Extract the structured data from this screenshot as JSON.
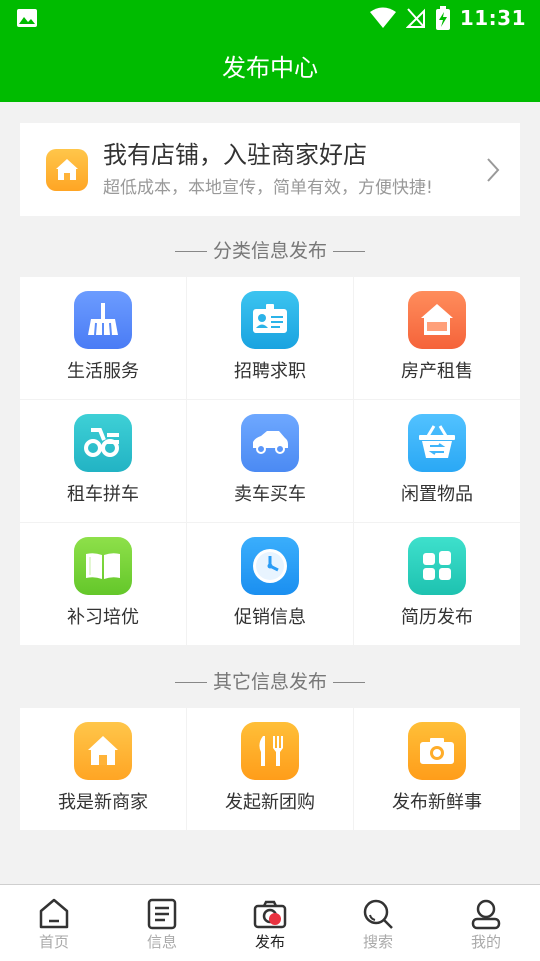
{
  "status_bar": {
    "time": "11:31"
  },
  "header": {
    "title": "发布中心",
    "background": "#00bb00"
  },
  "merchant_banner": {
    "title": "我有店铺，入驻商家好店",
    "subtitle": "超低成本，本地宣传，简单有效，方便快捷!"
  },
  "category_section": {
    "title": "分类信息发布",
    "items": [
      {
        "label": "生活服务",
        "icon": "broom-icon"
      },
      {
        "label": "招聘求职",
        "icon": "id-card-icon"
      },
      {
        "label": "房产租售",
        "icon": "house-icon"
      },
      {
        "label": "租车拼车",
        "icon": "bike-icon"
      },
      {
        "label": "卖车买车",
        "icon": "car-icon"
      },
      {
        "label": "闲置物品",
        "icon": "basket-icon"
      },
      {
        "label": "补习培优",
        "icon": "book-icon"
      },
      {
        "label": "促销信息",
        "icon": "clock-icon"
      },
      {
        "label": "简历发布",
        "icon": "blocks-icon"
      }
    ]
  },
  "other_section": {
    "title": "其它信息发布",
    "items": [
      {
        "label": "我是新商家",
        "icon": "shop-icon"
      },
      {
        "label": "发起新团购",
        "icon": "cutlery-icon"
      },
      {
        "label": "发布新鲜事",
        "icon": "camera-icon"
      }
    ]
  },
  "bottom_nav": {
    "items": [
      {
        "label": "首页",
        "icon": "home-icon",
        "active": false
      },
      {
        "label": "信息",
        "icon": "list-icon",
        "active": false
      },
      {
        "label": "发布",
        "icon": "camera-icon",
        "active": true
      },
      {
        "label": "搜索",
        "icon": "search-icon",
        "active": false
      },
      {
        "label": "我的",
        "icon": "user-icon",
        "active": false
      }
    ]
  },
  "colors": {
    "accent_green": "#00bb00",
    "active_red": "#e8313f"
  }
}
